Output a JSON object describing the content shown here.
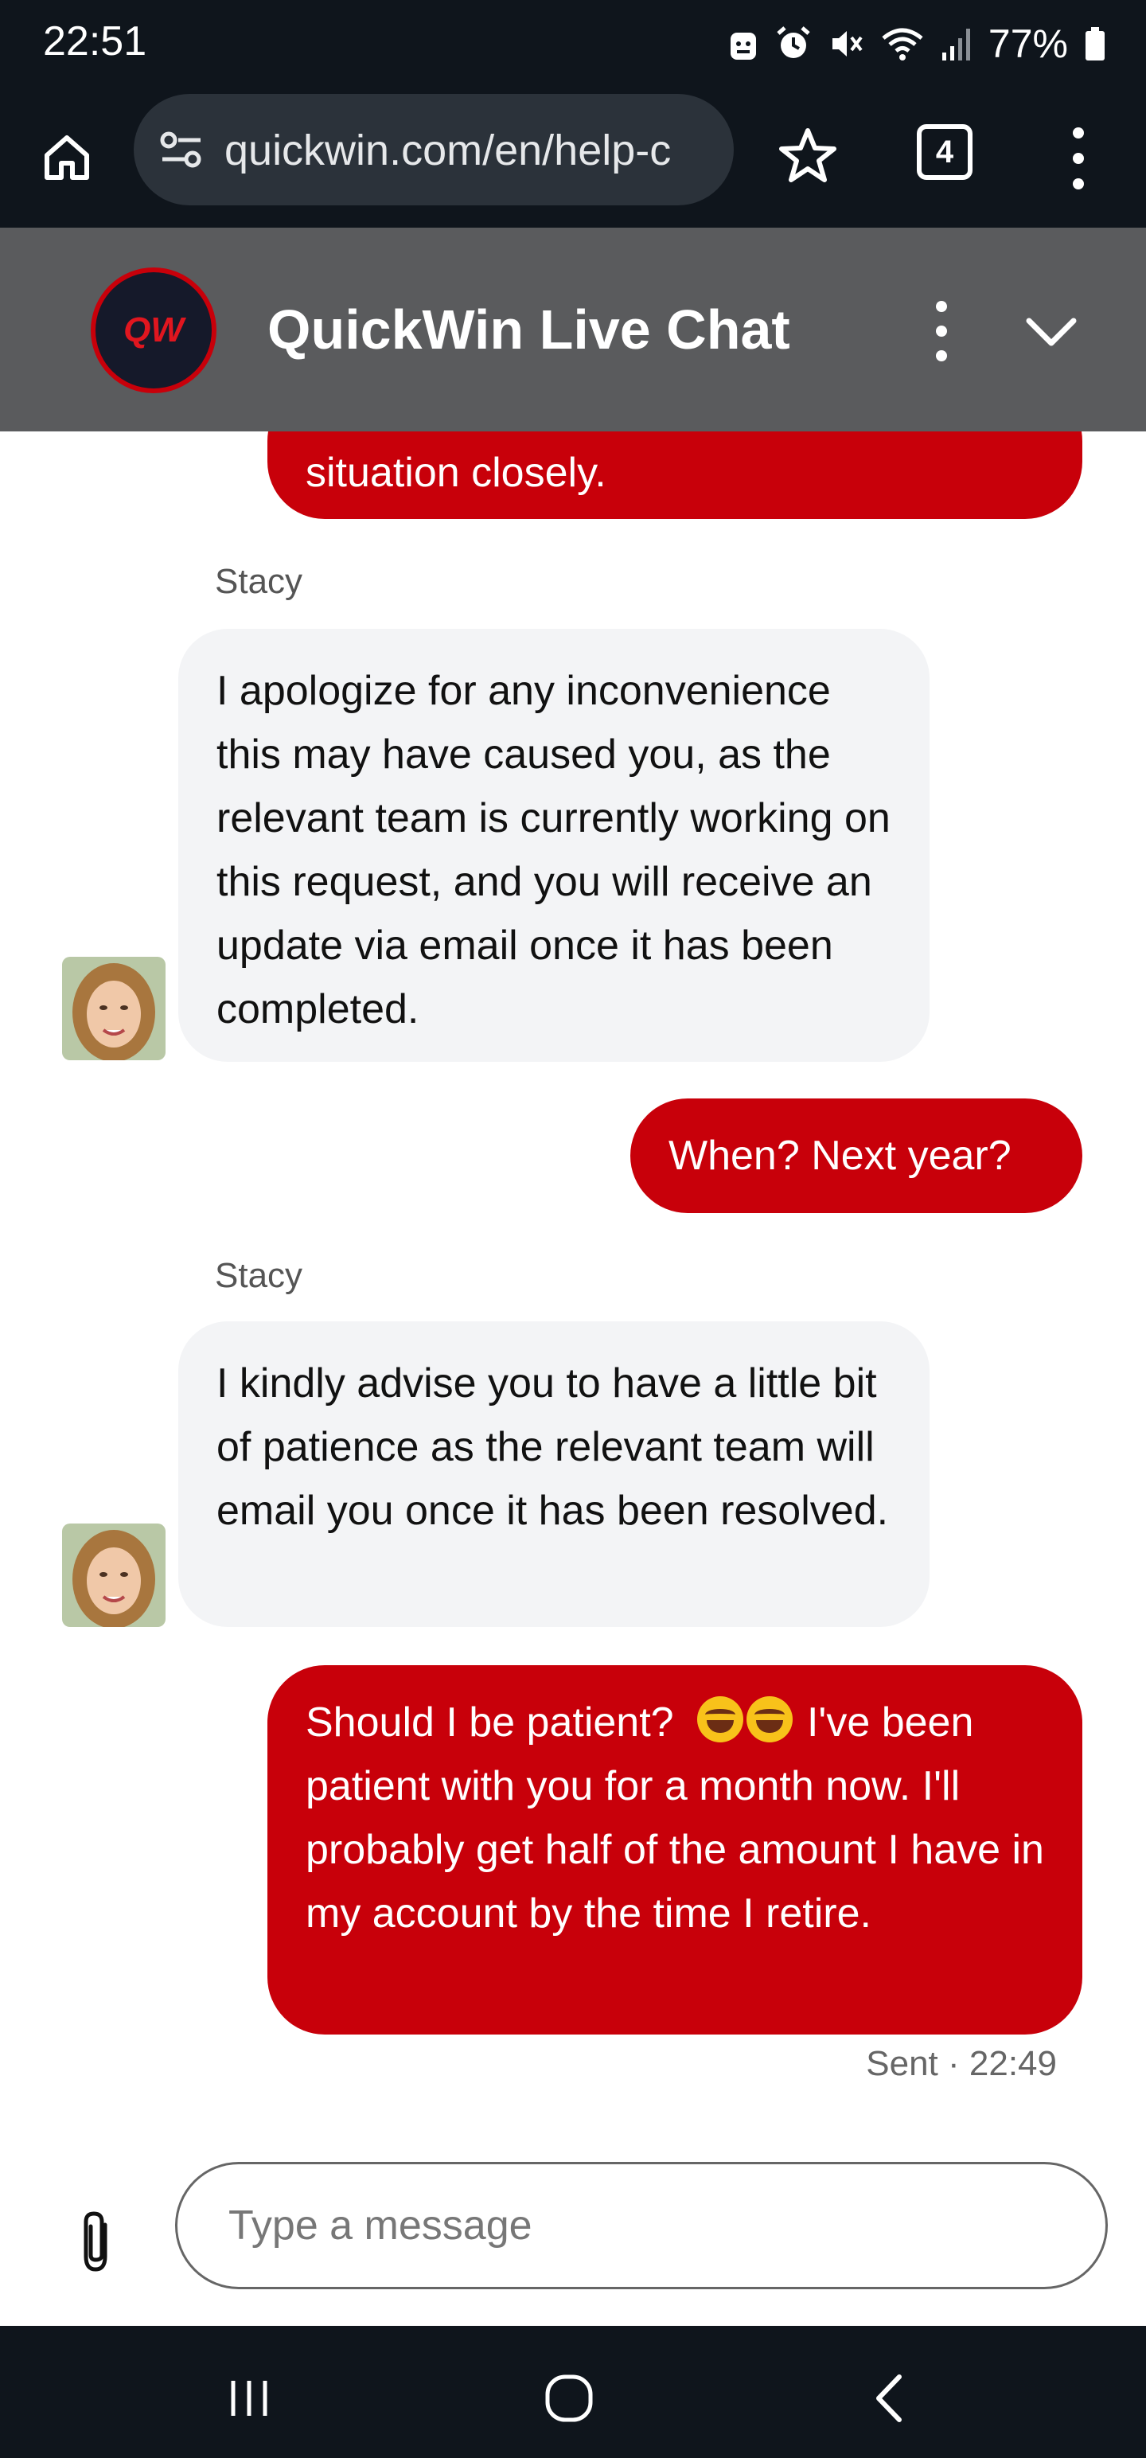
{
  "status_bar": {
    "time": "22:51",
    "battery": "77%",
    "icons": [
      "android-icon",
      "alarm-icon",
      "mute-icon",
      "wifi-icon",
      "signal-icon",
      "battery-icon"
    ]
  },
  "browser": {
    "url": "quickwin.com/en/help-c",
    "tab_count": "4",
    "icons": [
      "home-icon",
      "site-settings-icon",
      "star-icon",
      "tabs-icon",
      "more-vert-icon"
    ]
  },
  "chat_header": {
    "logo_text": "QW",
    "title": "QuickWin Live Chat",
    "icons": [
      "more-vert-icon",
      "chevron-down-icon"
    ]
  },
  "messages": [
    {
      "sender": "user",
      "text": "situation closely."
    },
    {
      "sender": "agent",
      "name": "Stacy",
      "text": "I apologize for any inconvenience this may have caused you, as the relevant team is currently working on this request, and you will receive an update via email once it has been completed."
    },
    {
      "sender": "user",
      "text": "When? Next year?"
    },
    {
      "sender": "agent",
      "name": "Stacy",
      "text": "I kindly advise you to have a little bit of patience as the relevant team will email you once it has been resolved."
    },
    {
      "sender": "user",
      "text_before_emoji": "Should I be patient?",
      "emoji": "🤣🤣",
      "text_after_emoji": "I've been patient with you for a month now. I'll probably get half of the amount I have in my account by the time I retire."
    }
  ],
  "sent_status": "Sent · 22:49",
  "composer": {
    "placeholder": "Type a message",
    "value": ""
  },
  "colors": {
    "accent": "#c8000a",
    "header": "#5a5b5d",
    "system_bar": "#0f151c",
    "agent_bubble": "#f3f4f6"
  }
}
